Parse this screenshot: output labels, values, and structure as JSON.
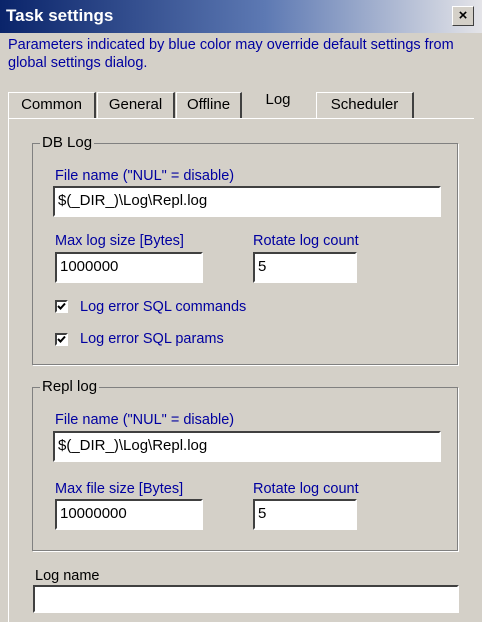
{
  "window": {
    "title": "Task settings",
    "close_label": "×"
  },
  "description": "Parameters indicated by blue color may override default settings from global settings dialog.",
  "tabs": [
    {
      "label": "Common"
    },
    {
      "label": "General"
    },
    {
      "label": "Offline"
    },
    {
      "label": "Log",
      "active": true
    },
    {
      "label": "Scheduler"
    }
  ],
  "db_log": {
    "legend": "DB Log",
    "file_name_label": "File name (\"NUL\" = disable)",
    "file_name_value": "$(_DIR_)\\Log\\Repl.log",
    "max_size_label": "Max log size [Bytes]",
    "max_size_value": "1000000",
    "rotate_label": "Rotate log count",
    "rotate_value": "5",
    "chk_sql_commands": {
      "label": "Log error SQL commands",
      "checked": true
    },
    "chk_sql_params": {
      "label": "Log error SQL params",
      "checked": true
    }
  },
  "repl_log": {
    "legend": "Repl log",
    "file_name_label": "File name (\"NUL\" = disable)",
    "file_name_value": "$(_DIR_)\\Log\\Repl.log",
    "max_size_label": "Max file size [Bytes]",
    "max_size_value": "10000000",
    "rotate_label": "Rotate log count",
    "rotate_value": "5"
  },
  "log_name": {
    "label": "Log name",
    "value": ""
  },
  "colors": {
    "title_start": "#0a246a",
    "label_blue": "#0000a0",
    "face": "#d4d0c8"
  }
}
